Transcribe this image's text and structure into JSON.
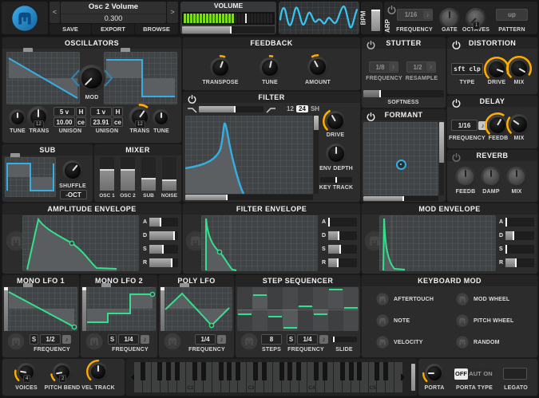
{
  "patch": {
    "prev": "<",
    "next": ">",
    "name": "Osc 2 Volume",
    "value": "0.300",
    "save": "SAVE",
    "export": "EXPORT",
    "browse": "BROWSE"
  },
  "volume": {
    "label": "VOLUME",
    "meter_level": 0.57,
    "peak": 0.68,
    "slider_value": 0.53
  },
  "bpm": {
    "label": "BPM"
  },
  "arp": {
    "label": "ARP",
    "frequency_value": "1/16",
    "frequency_label": "FREQUENCY",
    "gate_label": "GATE",
    "octaves_label": "OCTAVES",
    "octaves_value": "1",
    "pattern_value": "up",
    "pattern_label": "PATTERN"
  },
  "oscillators": {
    "title": "OSCILLATORS",
    "mod_label": "MOD",
    "osc1": {
      "tune_label": "TUNE",
      "trans_label": "TRANS",
      "trans_value": "12",
      "unison_voices": "5",
      "unison_v": "v",
      "unison_h": "H",
      "unison_detune": "10.00",
      "unison_cents": "ce",
      "unison_label": "UNISON"
    },
    "osc2": {
      "tune_label": "TUNE",
      "trans_label": "TRANS",
      "trans_value": "12",
      "unison_voices": "1",
      "unison_v": "v",
      "unison_h": "H",
      "unison_detune": "23.91",
      "unison_cents": "ce",
      "unison_label": "UNISON"
    }
  },
  "sub": {
    "title": "SUB",
    "shuffle_label": "SHUFFLE",
    "octave_button": "-OCT"
  },
  "mixer": {
    "title": "MIXER",
    "channels": [
      {
        "label": "OSC 1",
        "level": 0.65
      },
      {
        "label": "OSC 2",
        "level": 0.65
      },
      {
        "label": "SUB",
        "level": 0.38
      },
      {
        "label": "NOISE",
        "level": 0.33
      }
    ]
  },
  "feedback": {
    "title": "FEEDBACK",
    "transpose_label": "TRANSPOSE",
    "tune_label": "TUNE",
    "amount_label": "AMOUNT"
  },
  "filter": {
    "title": "FILTER",
    "poles": [
      "12",
      "24",
      "SH"
    ],
    "selected_pole": "24",
    "drive_label": "DRIVE",
    "env_depth_label": "ENV DEPTH",
    "key_track_label": "KEY TRACK"
  },
  "stutter": {
    "title": "STUTTER",
    "frequency_value": "1/8",
    "frequency_label": "FREQUENCY",
    "resample_value": "1/2",
    "resample_label": "RESAMPLE",
    "softness_label": "SOFTNESS"
  },
  "formant": {
    "title": "FORMANT"
  },
  "distortion": {
    "title": "DISTORTION",
    "type_value": "sft clp",
    "type_label": "TYPE",
    "drive_label": "DRIVE",
    "mix_label": "MIX"
  },
  "delay": {
    "title": "DELAY",
    "frequency_value": "1/16",
    "frequency_label": "FREQUENCY",
    "feedback_label": "FEEDB",
    "mix_label": "MIX"
  },
  "reverb": {
    "title": "REVERB",
    "feedback_label": "FEEDB",
    "damp_label": "DAMP",
    "mix_label": "MIX"
  },
  "envelopes": {
    "adsr_labels": [
      "A",
      "D",
      "S",
      "R"
    ],
    "amplitude": {
      "title": "AMPLITUDE ENVELOPE",
      "adsr": [
        0.4,
        0.87,
        0.47,
        0.77
      ]
    },
    "filter": {
      "title": "FILTER ENVELOPE",
      "adsr": [
        0.03,
        0.36,
        0.42,
        0.34
      ]
    },
    "mod": {
      "title": "MOD ENVELOPE",
      "adsr": [
        0.03,
        0.27,
        0.03,
        0.37
      ]
    }
  },
  "lfo1": {
    "title": "MONO LFO 1",
    "sync_label": "S",
    "frequency_value": "1/2",
    "frequency_label": "FREQUENCY"
  },
  "lfo2": {
    "title": "MONO LFO 2",
    "sync_label": "S",
    "frequency_value": "1/4",
    "frequency_label": "FREQUENCY"
  },
  "lfo3": {
    "title": "POLY LFO",
    "frequency_value": "1/4",
    "frequency_label": "FREQUENCY"
  },
  "step_sequencer": {
    "title": "STEP SEQUENCER",
    "steps_value": "8",
    "steps_label": "STEPS",
    "sync_label": "S",
    "frequency_value": "1/4",
    "frequency_label": "FREQUENCY",
    "slide_label": "SLIDE",
    "values": [
      -0.25,
      0.63,
      -0.34,
      -0.85,
      0.14,
      -0.25,
      0.89,
      0.06
    ]
  },
  "keyboard_mod": {
    "title": "KEYBOARD MOD",
    "items": [
      "AFTERTOUCH",
      "NOTE",
      "VELOCITY",
      "MOD WHEEL",
      "PITCH WHEEL",
      "RANDOM"
    ]
  },
  "performance": {
    "voices_label": "VOICES",
    "voices_value": "4",
    "pitch_bend_label": "PITCH BEND",
    "pitch_bend_value": "2",
    "vel_track_label": "VEL TRACK"
  },
  "keyboard": {
    "octave_labels": [
      "C2",
      "C3",
      "C4",
      "C5"
    ]
  },
  "porta": {
    "label": "PORTA",
    "type_label": "PORTA TYPE",
    "type_options": [
      "OFF",
      "AUT",
      "ON"
    ],
    "selected_type": "OFF",
    "legato_label": "LEGATO"
  }
}
